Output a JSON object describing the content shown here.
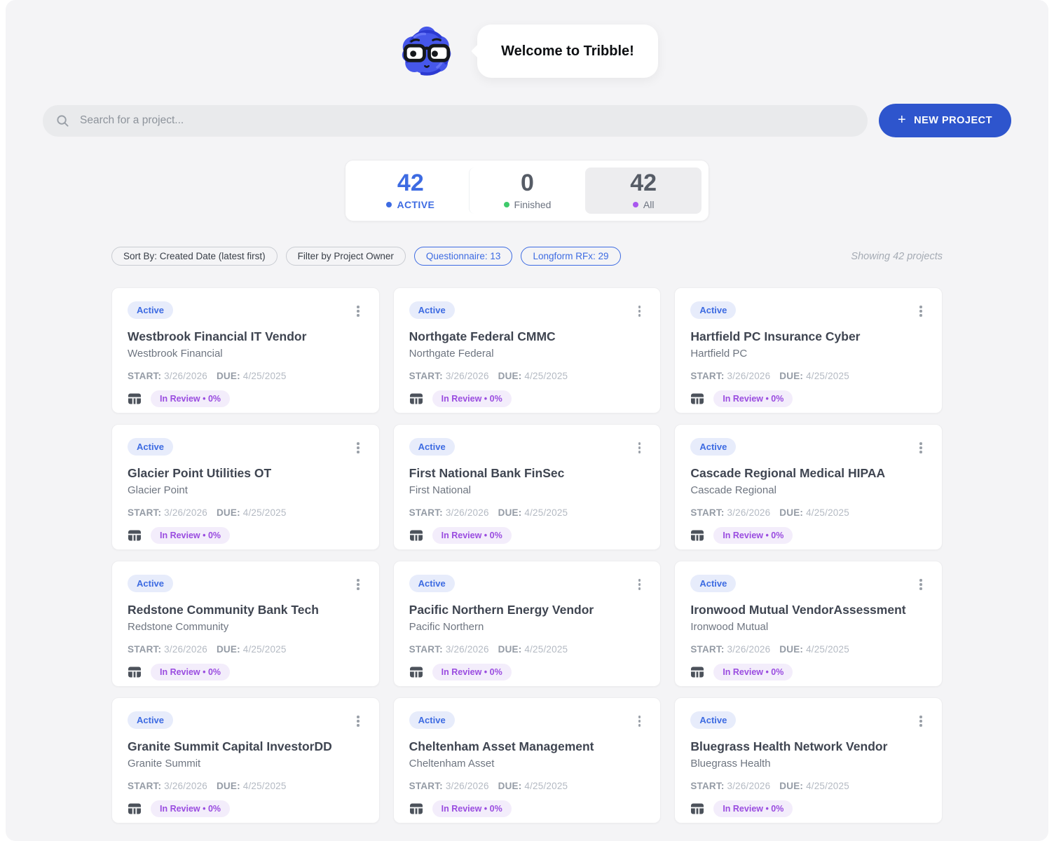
{
  "header": {
    "welcome_text": "Welcome to Tribble!"
  },
  "search": {
    "placeholder": "Search for a project..."
  },
  "new_project_button": {
    "label": "NEW PROJECT",
    "plus": "+"
  },
  "stats": {
    "active": {
      "value": "42",
      "label": "ACTIVE",
      "dot_color": "#3d6be2"
    },
    "finished": {
      "value": "0",
      "label": "Finished",
      "dot_color": "#3fca6b"
    },
    "all": {
      "value": "42",
      "label": "All",
      "dot_color": "#a957ef"
    }
  },
  "filters": {
    "sort": "Sort By: Created Date (latest first)",
    "owner": "Filter by Project Owner",
    "questionnaire": "Questionnaire: 13",
    "longform": "Longform RFx: 29",
    "showing_text": "Showing 42 projects"
  },
  "card_labels": {
    "start": "START:",
    "due": "DUE:"
  },
  "colors": {
    "accent_blue": "#2e55cd",
    "link_blue": "#3d6be2",
    "status_purple": "#9a4ce0",
    "finished_green": "#3fca6b",
    "all_violet": "#a957ef",
    "page_bg": "#f4f4f6"
  },
  "cards": [
    {
      "status": "Active",
      "title": "Westbrook Financial IT Vendor",
      "subtitle": "Westbrook Financial",
      "start": "3/26/2026",
      "due": "4/25/2025",
      "review": "In Review • 0%"
    },
    {
      "status": "Active",
      "title": "Northgate Federal CMMC",
      "subtitle": "Northgate Federal",
      "start": "3/26/2026",
      "due": "4/25/2025",
      "review": "In Review • 0%"
    },
    {
      "status": "Active",
      "title": "Hartfield PC Insurance Cyber",
      "subtitle": "Hartfield PC",
      "start": "3/26/2026",
      "due": "4/25/2025",
      "review": "In Review • 0%"
    },
    {
      "status": "Active",
      "title": "Glacier Point Utilities OT",
      "subtitle": "Glacier Point",
      "start": "3/26/2026",
      "due": "4/25/2025",
      "review": "In Review • 0%"
    },
    {
      "status": "Active",
      "title": "First National Bank FinSec",
      "subtitle": "First National",
      "start": "3/26/2026",
      "due": "4/25/2025",
      "review": "In Review • 0%"
    },
    {
      "status": "Active",
      "title": "Cascade Regional Medical HIPAA",
      "subtitle": "Cascade Regional",
      "start": "3/26/2026",
      "due": "4/25/2025",
      "review": "In Review • 0%"
    },
    {
      "status": "Active",
      "title": "Redstone Community Bank Tech",
      "subtitle": "Redstone Community",
      "start": "3/26/2026",
      "due": "4/25/2025",
      "review": "In Review • 0%"
    },
    {
      "status": "Active",
      "title": "Pacific Northern Energy Vendor",
      "subtitle": "Pacific Northern",
      "start": "3/26/2026",
      "due": "4/25/2025",
      "review": "In Review • 0%"
    },
    {
      "status": "Active",
      "title": "Ironwood Mutual VendorAssessment",
      "subtitle": "Ironwood Mutual",
      "start": "3/26/2026",
      "due": "4/25/2025",
      "review": "In Review • 0%"
    },
    {
      "status": "Active",
      "title": "Granite Summit Capital InvestorDD",
      "subtitle": "Granite Summit",
      "start": "3/26/2026",
      "due": "4/25/2025",
      "review": "In Review • 0%"
    },
    {
      "status": "Active",
      "title": "Cheltenham Asset Management",
      "subtitle": "Cheltenham Asset",
      "start": "3/26/2026",
      "due": "4/25/2025",
      "review": "In Review • 0%"
    },
    {
      "status": "Active",
      "title": "Bluegrass Health Network Vendor",
      "subtitle": "Bluegrass Health",
      "start": "3/26/2026",
      "due": "4/25/2025",
      "review": "In Review • 0%"
    }
  ]
}
